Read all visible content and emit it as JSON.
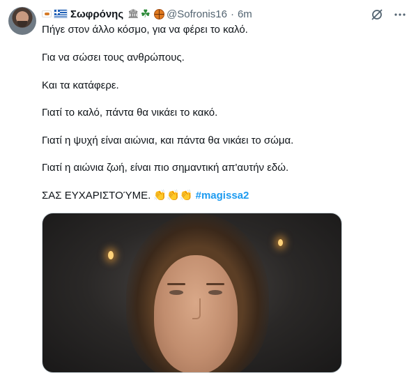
{
  "tweet": {
    "display_name": "Σωφρόνης",
    "handle": "@Sofronis16",
    "separator": "·",
    "time": "6m",
    "icons": [
      "greek-flag-icon",
      "bank-icon",
      "shamrock-icon",
      "basketball-icon",
      "grok-icon",
      "more-icon"
    ],
    "lines": [
      "Πήγε στον άλλο κόσμο, για να φέρει το καλό.",
      "Για να σώσει τους ανθρώπους.",
      "Και τα κατάφερε.",
      "Γιατί το καλό, πάντα θα νικάει το κακό.",
      "Γιατί η ψυχή είναι αιώνια, και πάντα θα νικάει το σώμα.",
      "Γιατί η αιώνια ζωή, είναι πιο σημαντική απ'αυτήν εδώ."
    ],
    "last_line_text": "ΣΑΣ ΕΥΧΑΡΙΣΤΟΎΜΕ.",
    "claps": "👏👏👏",
    "hashtag": "#magissa2"
  },
  "colors": {
    "text": "#0f1419",
    "secondary": "#536471",
    "link": "#1d9bf0"
  }
}
